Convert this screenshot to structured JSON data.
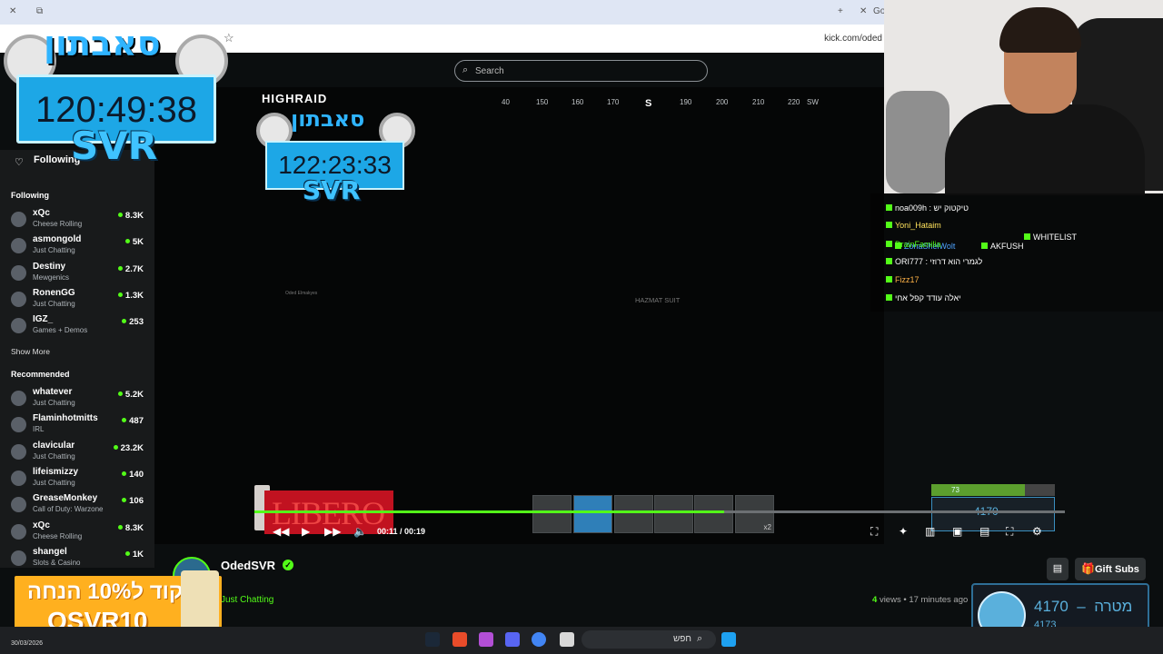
{
  "browser": {
    "url": "kick.com/oded",
    "tab_partial": "Go"
  },
  "site": {
    "search_placeholder": "Search",
    "following_label": "Following",
    "following_section": "Following",
    "recommended_section": "Recommended",
    "show_more": "Show More",
    "following": [
      {
        "name": "xQc",
        "category": "Cheese Rolling",
        "viewers": "8.3K"
      },
      {
        "name": "asmongold",
        "category": "Just Chatting",
        "viewers": "5K"
      },
      {
        "name": "Destiny",
        "category": "Mewgenics",
        "viewers": "2.7K"
      },
      {
        "name": "RonenGG",
        "category": "Just Chatting",
        "viewers": "1.3K"
      },
      {
        "name": "IGZ_",
        "category": "Games + Demos",
        "viewers": "253"
      }
    ],
    "recommended": [
      {
        "name": "whatever",
        "category": "Just Chatting",
        "viewers": "5.2K"
      },
      {
        "name": "Flaminhotmitts",
        "category": "IRL",
        "viewers": "487"
      },
      {
        "name": "clavicular",
        "category": "Just Chatting",
        "viewers": "23.2K"
      },
      {
        "name": "lifeismizzy",
        "category": "Just Chatting",
        "viewers": "140"
      },
      {
        "name": "GreaseMonkey",
        "category": "Call of Duty: Warzone",
        "viewers": "106"
      },
      {
        "name": "xQc",
        "category": "Cheese Rolling",
        "viewers": "8.3K"
      },
      {
        "name": "shangel",
        "category": "Slots & Casino",
        "viewers": "1K"
      }
    ]
  },
  "player": {
    "compass": [
      "40",
      "150",
      "160",
      "170",
      "S",
      "190",
      "200",
      "210",
      "220",
      "SW"
    ],
    "hazmat": "HAZMAT SUIT",
    "killfeed": [
      "Oded Elmakyes"
    ],
    "current_time": "00:11",
    "duration": "00:19",
    "progress": 0.58,
    "health": "73",
    "health_fraction": 0.76,
    "hotbar_count": "x2",
    "highraid": "HIGHRAID"
  },
  "channel": {
    "name": "OdedSVR",
    "category": "Just Chatting",
    "views_count": "4",
    "views_label": "views",
    "age": "17 minutes ago",
    "gift_label": "Gift Subs"
  },
  "overlay": {
    "timer_main": "120:49:38",
    "timer_small": "122:23:33",
    "svr": "SVR",
    "title_heb": "סאבתון",
    "promo_line1": "קוד ל10% הנחה",
    "promo_line2": "OSVR10"
  },
  "chat": [
    "noa009h : טיקטוק יש",
    "Yoni_Hataim",
    "WHITELIST",
    "ZonaShelWolt",
    "DrainFamilia",
    "AKFUSH",
    "ORI777 : לגמרי הוא דרוזי",
    "Fizz17",
    "יאלה עודד קפל אחי"
  ],
  "goal": {
    "label": "מטרה",
    "main": "4170",
    "sub": "4173"
  },
  "taskbar": {
    "search": "חפש",
    "date": "30/03/2026"
  }
}
